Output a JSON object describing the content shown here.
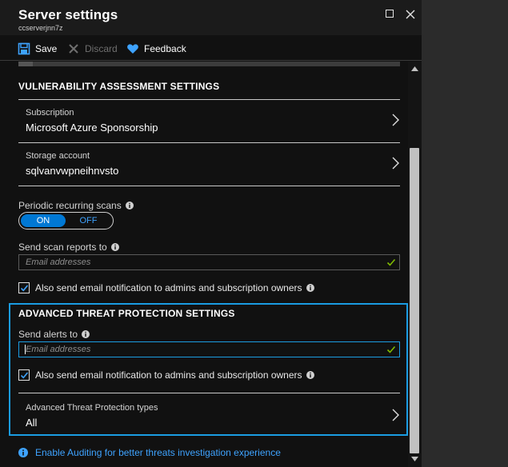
{
  "header": {
    "title": "Server settings",
    "subtitle": "ccserverjnn7z"
  },
  "toolbar": {
    "save_label": "Save",
    "discard_label": "Discard",
    "feedback_label": "Feedback"
  },
  "vulnerability": {
    "section_title": "VULNERABILITY ASSESSMENT SETTINGS",
    "subscription_label": "Subscription",
    "subscription_value": "Microsoft Azure Sponsorship",
    "storage_label": "Storage account",
    "storage_value": "sqlvanvwpneihnvsto",
    "periodic_label": "Periodic recurring scans",
    "toggle_on": "ON",
    "toggle_off": "OFF",
    "send_reports_label": "Send scan reports to",
    "email_placeholder": "Email addresses",
    "also_send_label": "Also send email notification to admins and subscription owners"
  },
  "threat": {
    "section_title": "ADVANCED THREAT PROTECTION SETTINGS",
    "send_alerts_label": "Send alerts to",
    "email_placeholder": "Email addresses",
    "also_send_label": "Also send email notification to admins and subscription owners",
    "types_label": "Advanced Threat Protection types",
    "types_value": "All"
  },
  "footer": {
    "auditing_link": "Enable Auditing for better threats investigation experience"
  },
  "colors": {
    "accent": "#1a9ce2",
    "toggle_on": "#0078d4",
    "link": "#3ea3ff",
    "check_ok": "#7fba00",
    "panel_bg": "#111111"
  },
  "icons": [
    "save-icon",
    "discard-icon",
    "feedback-heart-icon",
    "maximize-icon",
    "close-icon",
    "chevron-right-icon",
    "info-icon",
    "checkmark-icon"
  ]
}
